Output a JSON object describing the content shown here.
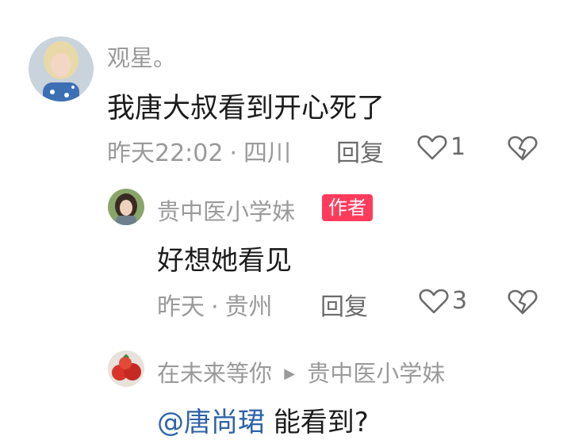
{
  "comment": {
    "username": "观星。",
    "text": "我唐大叔看到开心死了",
    "time": "昨天22:02",
    "location": "四川",
    "reply_label": "回复",
    "likes": "1"
  },
  "reply1": {
    "username": "贵中医小学妹",
    "author_badge": "作者",
    "text": "好想她看见",
    "time": "昨天",
    "location": "贵州",
    "reply_label": "回复",
    "likes": "3"
  },
  "reply2": {
    "username": "在未来等你",
    "reply_to": "贵中医小学妹",
    "mention": "@唐尚珺",
    "text": "能看到?"
  },
  "colors": {
    "badge": "#ff3b5c",
    "mention": "#2f63a8",
    "meta_gray": "#9a9a9a"
  },
  "icons": [
    "heart-icon",
    "broken-heart-icon",
    "reply-arrow-icon"
  ]
}
